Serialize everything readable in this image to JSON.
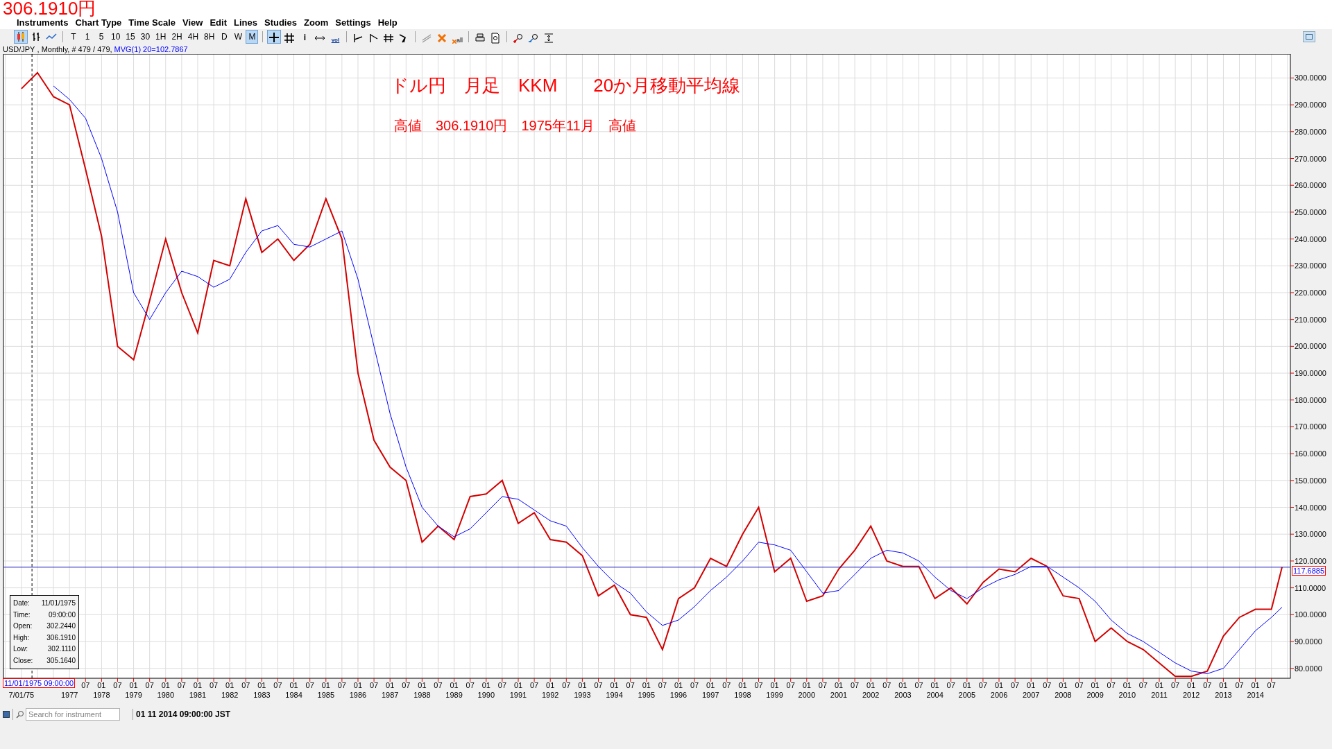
{
  "price_title": "306.1910円",
  "menu": [
    "Instruments",
    "Chart Type",
    "Time Scale",
    "View",
    "Edit",
    "Lines",
    "Studies",
    "Zoom",
    "Settings",
    "Help"
  ],
  "toolbar": {
    "chart_types": [
      {
        "selected": true
      },
      {
        "selected": false
      },
      {
        "selected": false
      }
    ],
    "timeframes": [
      {
        "label": "T",
        "selected": false
      },
      {
        "label": "1",
        "selected": false
      },
      {
        "label": "5",
        "selected": false
      },
      {
        "label": "10",
        "selected": false
      },
      {
        "label": "15",
        "selected": false
      },
      {
        "label": "30",
        "selected": false
      },
      {
        "label": "1H",
        "selected": false
      },
      {
        "label": "2H",
        "selected": false
      },
      {
        "label": "4H",
        "selected": false
      },
      {
        "label": "8H",
        "selected": false
      },
      {
        "label": "D",
        "selected": false
      },
      {
        "label": "W",
        "selected": false
      },
      {
        "label": "M",
        "selected": true
      }
    ],
    "tools": [
      {
        "selected": true
      },
      {
        "selected": false
      },
      {
        "selected": false,
        "label": "i"
      },
      {
        "selected": false
      },
      {
        "selected": false,
        "label": "vol"
      },
      {
        "selected": false
      },
      {
        "selected": false
      },
      {
        "selected": false
      },
      {
        "selected": false
      },
      {
        "selected": false
      },
      {
        "selected": false
      },
      {
        "selected": false,
        "label": "all"
      },
      {
        "selected": false
      },
      {
        "selected": false
      },
      {
        "selected": false
      },
      {
        "selected": false
      },
      {
        "selected": false
      }
    ]
  },
  "info": {
    "instrument_rest": " , Monthly, # 479 / 479,",
    "study_value": "=102.7867"
  },
  "chart": {
    "chart_data": {
      "type": "line",
      "grid": true,
      "xlim": [
        1974.94,
        2015.09
      ],
      "ylim": [
        76.3,
        308.9
      ],
      "ref_lines": [
        {
          "axis": "y",
          "value": 117.6885,
          "color": "#2020c0"
        },
        {
          "axis": "x",
          "value": 1975.83,
          "color": "#000000"
        }
      ],
      "x": [
        1975.5,
        1976,
        1976.5,
        1977,
        1977.5,
        1978,
        1978.5,
        1979,
        1979.5,
        1980,
        1980.5,
        1981,
        1981.5,
        1982,
        1982.5,
        1983,
        1983.5,
        1984,
        1984.5,
        1985,
        1985.5,
        1986,
        1986.5,
        1987,
        1987.5,
        1988,
        1988.5,
        1989,
        1989.5,
        1990,
        1990.5,
        1991,
        1991.5,
        1992,
        1992.5,
        1993,
        1993.5,
        1994,
        1994.5,
        1995,
        1995.5,
        1996,
        1996.5,
        1997,
        1997.5,
        1998,
        1998.5,
        1999,
        1999.5,
        2000,
        2000.5,
        2001,
        2001.5,
        2002,
        2002.5,
        2003,
        2003.5,
        2004,
        2004.5,
        2005,
        2005.5,
        2006,
        2006.5,
        2007,
        2007.5,
        2008,
        2008.5,
        2009,
        2009.5,
        2010,
        2010.5,
        2011,
        2011.5,
        2012,
        2012.5,
        2013,
        2013.5,
        2014,
        2014.5,
        2014.83
      ],
      "series": [
        {
          "name": "USD/JPY",
          "color": "#d40000",
          "values": [
            296,
            302,
            293,
            290,
            266,
            241,
            200,
            195,
            217,
            240,
            220,
            205,
            232,
            230,
            255,
            235,
            240,
            232,
            238,
            255,
            240,
            190,
            165,
            155,
            150,
            127,
            133,
            128,
            144,
            145,
            150,
            134,
            138,
            128,
            127,
            122,
            107,
            111,
            100,
            99,
            87,
            106,
            110,
            121,
            118,
            130,
            140,
            116,
            121,
            105,
            107,
            117,
            124,
            133,
            120,
            118,
            118,
            106,
            110,
            104,
            112,
            117,
            116,
            121,
            118,
            107,
            106,
            90,
            95,
            90,
            87,
            82,
            77,
            77,
            79,
            92,
            99,
            102,
            102,
            117.7
          ]
        },
        {
          "name": "MVG(1) 20",
          "color": "#0000ff",
          "values": [
            null,
            null,
            297,
            292,
            285,
            270,
            250,
            220,
            210,
            220,
            228,
            226,
            222,
            225,
            235,
            243,
            245,
            238,
            237,
            240,
            243,
            225,
            200,
            175,
            155,
            140,
            133,
            129,
            132,
            138,
            144,
            143,
            139,
            135,
            133,
            125,
            118,
            112,
            108,
            101,
            96,
            98,
            103,
            109,
            114,
            120,
            127,
            126,
            124,
            116,
            108,
            109,
            115,
            121,
            124,
            123,
            120,
            114,
            109,
            106,
            110,
            113,
            115,
            118,
            118,
            114,
            110,
            105,
            98,
            93,
            90,
            86,
            82,
            79,
            78,
            80,
            87,
            94,
            99,
            102.8
          ]
        }
      ],
      "yticks": [
        {
          "value": 80,
          "label": "80.0000"
        },
        {
          "value": 90,
          "label": "90.0000"
        },
        {
          "value": 100,
          "label": "100.0000"
        },
        {
          "value": 110,
          "label": "110.0000"
        },
        {
          "value": 120,
          "label": "120.0000"
        },
        {
          "value": 130,
          "label": "130.0000"
        },
        {
          "value": 140,
          "label": "140.0000"
        },
        {
          "value": 150,
          "label": "150.0000"
        },
        {
          "value": 160,
          "label": "160.0000"
        },
        {
          "value": 170,
          "label": "170.0000"
        },
        {
          "value": 180,
          "label": "180.0000"
        },
        {
          "value": 190,
          "label": "190.0000"
        },
        {
          "value": 200,
          "label": "200.0000"
        },
        {
          "value": 210,
          "label": "210.0000"
        },
        {
          "value": 220,
          "label": "220.0000"
        },
        {
          "value": 230,
          "label": "230.0000"
        },
        {
          "value": 240,
          "label": "240.0000"
        },
        {
          "value": 250,
          "label": "250.0000"
        },
        {
          "value": 260,
          "label": "260.0000"
        },
        {
          "value": 270,
          "label": "270.0000"
        },
        {
          "value": 280,
          "label": "280.0000"
        },
        {
          "value": 290,
          "label": "290.0000"
        },
        {
          "value": 300,
          "label": "300.0000"
        }
      ],
      "xticks": [
        {
          "value": 1975.5,
          "label": "7/01/75"
        },
        {
          "value": 1977,
          "label": "1977"
        },
        {
          "value": 1978,
          "label": "1978"
        },
        {
          "value": 1979,
          "label": "1979"
        },
        {
          "value": 1980,
          "label": "1980"
        },
        {
          "value": 1981,
          "label": "1981"
        },
        {
          "value": 1982,
          "label": "1982"
        },
        {
          "value": 1983,
          "label": "1983"
        },
        {
          "value": 1984,
          "label": "1984"
        },
        {
          "value": 1985,
          "label": "1985"
        },
        {
          "value": 1986,
          "label": "1986"
        },
        {
          "value": 1987,
          "label": "1987"
        },
        {
          "value": 1988,
          "label": "1988"
        },
        {
          "value": 1989,
          "label": "1989"
        },
        {
          "value": 1990,
          "label": "1990"
        },
        {
          "value": 1991,
          "label": "1991"
        },
        {
          "value": 1992,
          "label": "1992"
        },
        {
          "value": 1993,
          "label": "1993"
        },
        {
          "value": 1994,
          "label": "1994"
        },
        {
          "value": 1995,
          "label": "1995"
        },
        {
          "value": 1996,
          "label": "1996"
        },
        {
          "value": 1997,
          "label": "1997"
        },
        {
          "value": 1998,
          "label": "1998"
        },
        {
          "value": 1999,
          "label": "1999"
        },
        {
          "value": 2000,
          "label": "2000"
        },
        {
          "value": 2001,
          "label": "2001"
        },
        {
          "value": 2002,
          "label": "2002"
        },
        {
          "value": 2003,
          "label": "2003"
        },
        {
          "value": 2004,
          "label": "2004"
        },
        {
          "value": 2005,
          "label": "2005"
        },
        {
          "value": 2006,
          "label": "2006"
        },
        {
          "value": 2007,
          "label": "2007"
        },
        {
          "value": 2008,
          "label": "2008"
        },
        {
          "value": 2009,
          "label": "2009"
        },
        {
          "value": 2010,
          "label": "2010"
        },
        {
          "value": 2011,
          "label": "2011"
        },
        {
          "value": 2012,
          "label": "2012"
        },
        {
          "value": 2013,
          "label": "2013"
        },
        {
          "value": 2014,
          "label": "2014"
        }
      ],
      "annotations": [
        {
          "text": "ドル円　月足　KKM　　20か月移動平均線"
        },
        {
          "text": "高値　306.1910円　1975年11月　高値"
        }
      ]
    },
    "month_labels": [
      "07",
      "01",
      "07",
      "01",
      "07",
      "01",
      "07",
      "01",
      "07",
      "01",
      "07",
      "01",
      "07",
      "01",
      "07",
      "01",
      "07",
      "01",
      "07",
      "01",
      "07",
      "01",
      "07",
      "01",
      "07",
      "01",
      "07",
      "01",
      "07",
      "01",
      "07",
      "01",
      "07",
      "01",
      "07",
      "01",
      "07",
      "01",
      "07",
      "01",
      "07",
      "01",
      "07",
      "01",
      "07",
      "01",
      "07",
      "01",
      "07",
      "01",
      "07",
      "01",
      "07",
      "01",
      "07",
      "01",
      "07",
      "01",
      "07",
      "01",
      "07",
      "01",
      "07",
      "01",
      "07",
      "01",
      "07",
      "01",
      "07",
      "01",
      "07",
      "01",
      "07",
      "01",
      "07"
    ],
    "cursor": {
      "label": "11/01/1975 09:00:00"
    },
    "price_line": {
      "label": "117.6885"
    },
    "tooltip": [
      {
        "label": "Date:",
        "value": "11/01/1975"
      },
      {
        "label": "Time:",
        "value": "09:00:00"
      },
      {
        "label": "Open:",
        "value": "302.2440"
      },
      {
        "label": "High:",
        "value": "306.1910"
      },
      {
        "label": "Low:",
        "value": "302.1110"
      },
      {
        "label": "Close:",
        "value": "305.1640"
      }
    ]
  },
  "status_bar": {
    "search_placeholder": "Search for instrument",
    "datetime": "01 11 2014 09:00:00 JST"
  }
}
